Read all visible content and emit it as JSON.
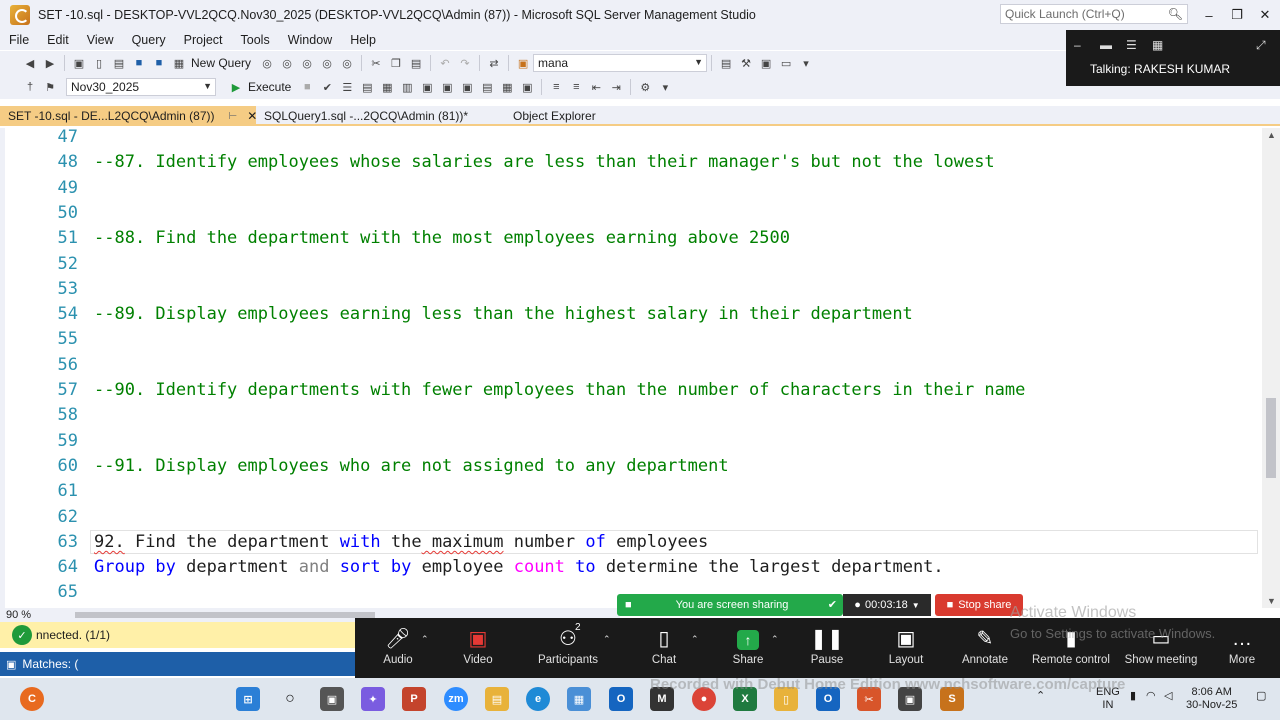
{
  "window": {
    "title": "SET -10.sql - DESKTOP-VVL2QCQ.Nov30_2025 (DESKTOP-VVL2QCQ\\Admin (87)) - Microsoft SQL Server Management Studio",
    "quick_launch_placeholder": "Quick Launch (Ctrl+Q)"
  },
  "menu": [
    "File",
    "Edit",
    "View",
    "Query",
    "Project",
    "Tools",
    "Window",
    "Help"
  ],
  "toolbar": {
    "new_query_label": "New Query",
    "search_combo_value": "mana",
    "database_combo_value": "Nov30_2025",
    "execute_label": "Execute"
  },
  "tabs": [
    {
      "label": "SET -10.sql - DE...L2QCQ\\Admin (87))",
      "active": true
    },
    {
      "label": "SQLQuery1.sql -...2QCQ\\Admin (81))*",
      "active": false
    },
    {
      "label": "Object Explorer",
      "active": false
    }
  ],
  "editor": {
    "lines": [
      {
        "num": "47",
        "text": ""
      },
      {
        "num": "48",
        "text": "--87. Identify employees whose salaries are less than their manager's but not the lowest"
      },
      {
        "num": "49",
        "text": ""
      },
      {
        "num": "50",
        "text": ""
      },
      {
        "num": "51",
        "text": "--88. Find the department with the most employees earning above 2500"
      },
      {
        "num": "52",
        "text": ""
      },
      {
        "num": "53",
        "text": ""
      },
      {
        "num": "54",
        "text": "--89. Display employees earning less than the highest salary in their department"
      },
      {
        "num": "55",
        "text": ""
      },
      {
        "num": "56",
        "text": ""
      },
      {
        "num": "57",
        "text": "--90. Identify departments with fewer employees than the number of characters in their name"
      },
      {
        "num": "58",
        "text": ""
      },
      {
        "num": "59",
        "text": ""
      },
      {
        "num": "60",
        "text": "--91. Display employees who are not assigned to any department"
      },
      {
        "num": "61",
        "text": ""
      },
      {
        "num": "62",
        "text": ""
      },
      {
        "num": "63",
        "text": ""
      },
      {
        "num": "64",
        "text": ""
      },
      {
        "num": "65",
        "text": ""
      }
    ],
    "line63": [
      "92.",
      " Find",
      " the",
      " department",
      " with",
      " the",
      " maximum",
      " number",
      " of",
      " employees"
    ],
    "line64": [
      "Group",
      " by",
      " department",
      " and",
      " sort",
      " by",
      " employee",
      " count",
      " to",
      " determine",
      " the",
      " largest",
      " department."
    ]
  },
  "status": {
    "zoom": "90 %",
    "connection": "nnected. (1/1)",
    "find": "Matches: ("
  },
  "zoom_meeting": {
    "talking": "Talking: RAKESH KUMAR",
    "sharing_banner": "You are screen sharing",
    "timer": "00:03:18",
    "stop_share": "Stop share",
    "participants_count": "2",
    "controls": [
      "Audio",
      "Video",
      "Participants",
      "Chat",
      "Share",
      "Pause",
      "Layout",
      "Annotate",
      "Remote control",
      "Show meeting",
      "More"
    ]
  },
  "overlay": {
    "activate_line1": "Activate Windows",
    "activate_line2": "Go to Settings to activate Windows.",
    "recorded": "Recorded with Debut Home Edition  www.nchsoftware.com/capture"
  },
  "taskbar": {
    "lang_top": "ENG",
    "lang_bottom": "IN",
    "time": "8:06 AM",
    "date": "30-Nov-25"
  }
}
